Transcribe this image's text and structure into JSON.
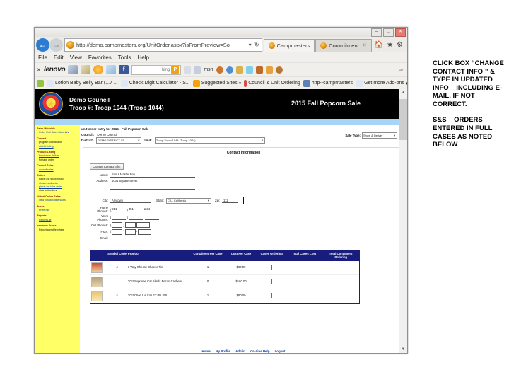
{
  "browser": {
    "window_buttons": [
      "–",
      "□",
      "✕"
    ],
    "address": {
      "url": "http://demo.campmasters.org/UnitOrder.aspx?isFromPreview=So",
      "tools": "▾  ↻"
    },
    "tabs": [
      {
        "label": "Campmasters",
        "active": true
      },
      {
        "label": "Commitment",
        "active": false,
        "close": "✕"
      }
    ],
    "window_icons": [
      "🏠",
      "★",
      "⚙"
    ],
    "menu": [
      "File",
      "Edit",
      "View",
      "Favorites",
      "Tools",
      "Help"
    ],
    "bookmarks_row1": {
      "close": "✕",
      "brand": "lenovo",
      "search_placeholder": "bing",
      "search_badge": "P",
      "msn": "msn",
      "dots": "∞"
    },
    "bookmarks_row2": [
      "Lotion Baby Belly Bar (1.7 ...",
      "Check Digit Calculator - S...",
      "Suggested Sites",
      "Council & Unit Ordering",
      "http--campmasters",
      "Get more Add-ons"
    ],
    "overflow": "»"
  },
  "page": {
    "banner": {
      "council": "Demo Council",
      "troop": "Troop #: Troop 1044 (Troop 1044)",
      "sale_title": "2015  Fall Popcorn Sale"
    },
    "unit_order_line": "unit order entry for 2015 - Fall Popcorn Sale",
    "council_district": {
      "council_label": "Council:",
      "council_value": "Demo Council",
      "district_label": "District:",
      "district_value": "DEMO DISTRICT #2",
      "unit_label": "Unit:",
      "unit_value": "Troop:Troop  1044 (Troop 1044)",
      "sale_type_label": "Sale Type:",
      "sale_type_value": "Show & Deliver",
      "caret": "▼"
    },
    "section_title": "Contact Information",
    "change_contact_button": "Change Contact Info.",
    "form": {
      "fields": [
        {
          "label": "Name:",
          "value": "Scout Master Boy"
        },
        {
          "label": "Address:",
          "value": "4001 Square Street"
        },
        {
          "label": "",
          "value": ""
        },
        {
          "label": "",
          "value": ""
        }
      ],
      "city_label": "City:",
      "city_value": "Anytown",
      "state_label": "State:",
      "state_value": "CA - California",
      "zip_label": "Zip:",
      "zip_value": "111",
      "home_label": "Home Phone#:",
      "home_area": "951",
      "home_pre": "451",
      "home_line": "1234",
      "work_label": "Work Phone#:",
      "cell_label": "Cell Phone#:",
      "fax_label": "Fax#:",
      "email_label": "Email:"
    },
    "table": {
      "headers": [
        "Symbol Code",
        "Product",
        "Containers Per Case",
        "Cost Per Case",
        "Cases Ordering",
        "Total Cases Cost",
        "Total Containers Ordering"
      ],
      "rows": [
        {
          "symbol": "4",
          "product": "3 Way Cheesy Cheese Tin",
          "per_case": "1",
          "cost": "$60.00"
        },
        {
          "symbol": "-",
          "product": "20ct Supreme Car Almds Pecan Cashew",
          "per_case": "0",
          "cost": "$160.00"
        },
        {
          "symbol": "4",
          "product": "20ct Choc Lvr Coll FT PN SW",
          "per_case": "1",
          "cost": "$80.00"
        }
      ]
    },
    "footer_links": [
      "Home",
      "My Profile",
      "Admin",
      "On-Line Help",
      "Logout"
    ]
  },
  "annotations": {
    "note1": "CLICK BOX “CHANGE CONTACT INFO ” & TYPE IN UPDATED INFO – INCLUDING E-MAIL. IF NOT CORRECT.",
    "note2": "S&S – ORDERS ENTERED IN FULL CASES AS NOTED BELOW"
  },
  "sidebar": {
    "groups": [
      {
        "head": "Sales Materials",
        "items": [],
        "links": [
          "Order Unit Sales Materials"
        ]
      },
      {
        "head": "Contact",
        "items": [
          "program coordinator"
        ],
        "links": [
          "district listing"
        ]
      },
      {
        "head": "Product Listing",
        "items": [
          "for take order"
        ],
        "links": [
          "for show-n-deliver"
        ]
      },
      {
        "head": "Council Sales",
        "items": [],
        "links": [
          "council sales"
        ]
      },
      {
        "head": "Orders",
        "items": [
          "place unit show-n-sell",
          "view unit orders"
        ],
        "links": [
          "show-n-sell order",
          "place unit take order"
        ]
      },
      {
        "head": "Virtual Online Sales",
        "items": [],
        "links": [
          "view virtual online sales"
        ]
      },
      {
        "head": "Prizes",
        "items": [],
        "links": [
          "Prize Site"
        ]
      },
      {
        "head": "Reports",
        "items": [],
        "links": [
          "Report List"
        ]
      },
      {
        "head": "Issues or Errors",
        "items": [
          "Report a problem here"
        ],
        "links": []
      }
    ]
  }
}
